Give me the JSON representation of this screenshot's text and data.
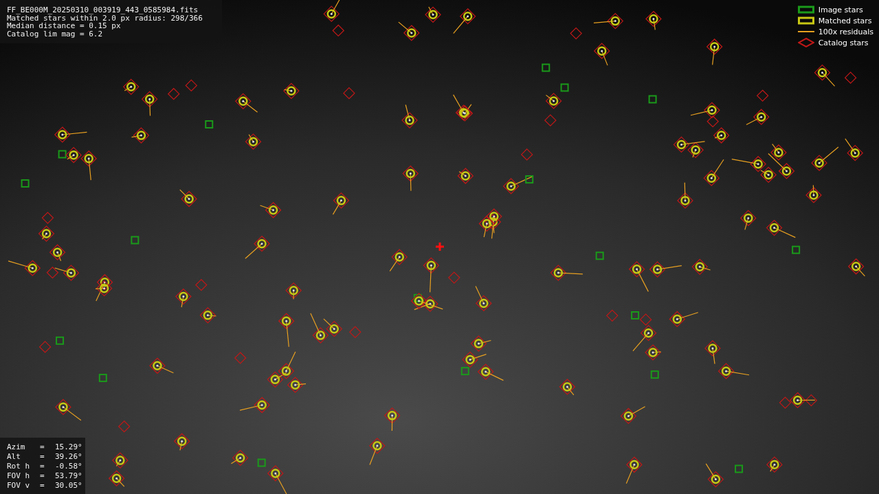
{
  "info_box": {
    "lines": [
      "FF_BE000M_20250310_003919_443_0585984.fits",
      "Matched stars within 2.0 px radius: 298/366",
      "Median distance = 0.15 px",
      "Catalog lim mag = 6.2"
    ]
  },
  "legend": {
    "items": [
      {
        "kind": "box",
        "label": "Image stars",
        "color": "#1a9a1a"
      },
      {
        "kind": "box",
        "label": "Matched stars",
        "color": "#c8c814"
      },
      {
        "kind": "line",
        "label": "100x residuals",
        "color": "#e8a020"
      },
      {
        "kind": "diamond",
        "label": "Catalog stars",
        "color": "#c01818"
      }
    ]
  },
  "pointing": {
    "rows": [
      {
        "label": "Azim",
        "sign": "=",
        "value": "15.29°"
      },
      {
        "label": "Alt",
        "sign": "=",
        "value": "39.26°"
      },
      {
        "label": "Rot h",
        "sign": "=",
        "value": "-0.58°"
      },
      {
        "label": "FOV h",
        "sign": "=",
        "value": "53.79°"
      },
      {
        "label": "FOV v",
        "sign": "=",
        "value": "30.05°"
      }
    ]
  }
}
